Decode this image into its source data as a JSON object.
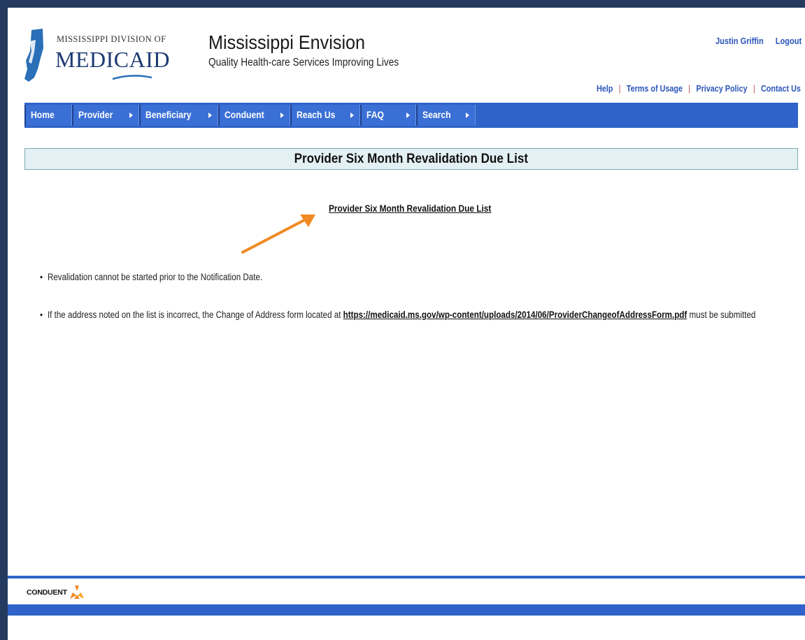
{
  "header": {
    "logo_top": "MISSISSIPPI DIVISION OF",
    "logo_main": "MEDICAID",
    "app_title": "Mississippi Envision",
    "tagline": "Quality Health-care Services Improving Lives",
    "user_name": "Justin Griffin",
    "logout": "Logout"
  },
  "util_links": {
    "help": "Help",
    "terms": "Terms of Usage",
    "privacy": "Privacy Policy",
    "contact": "Contact Us"
  },
  "nav": {
    "home": "Home",
    "provider": "Provider",
    "beneficiary": "Beneficiary",
    "conduent": "Conduent",
    "reach_us": "Reach Us",
    "faq": "FAQ",
    "search": "Search"
  },
  "main": {
    "section_title": "Provider Six Month Revalidation Due List",
    "due_list_link": "Provider Six Month Revalidation Due List",
    "note1": "Revalidation cannot be started prior to the Notification Date.",
    "note2_prefix": "If the address noted on the list is incorrect, the Change of Address form located at",
    "note2_link": "https://medicaid.ms.gov/wp-content/uploads/2014/06/ProviderChangeofAddressForm.pdf",
    "note2_suffix": "must be submitted"
  },
  "footer": {
    "brand": "CONDUENT"
  },
  "colors": {
    "nav_blue": "#2f63c9",
    "link_blue": "#2b56b8",
    "section_bg": "#e4f1f4",
    "arrow_orange": "#f08a24"
  }
}
